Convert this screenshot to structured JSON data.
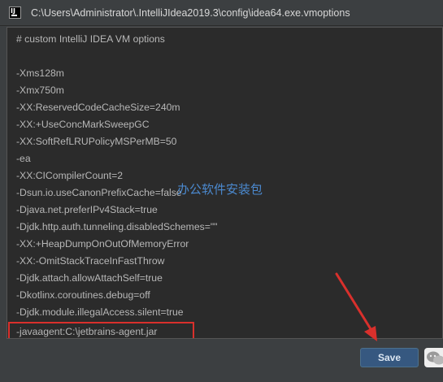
{
  "window": {
    "title": "C:\\Users\\Administrator\\.IntelliJIdea2019.3\\config\\idea64.exe.vmoptions",
    "icon_label": "IJ"
  },
  "editor": {
    "lines": [
      "# custom IntelliJ IDEA VM options",
      "",
      "-Xms128m",
      "-Xmx750m",
      "-XX:ReservedCodeCacheSize=240m",
      "-XX:+UseConcMarkSweepGC",
      "-XX:SoftRefLRUPolicyMSPerMB=50",
      "-ea",
      "-XX:CICompilerCount=2",
      "-Dsun.io.useCanonPrefixCache=false",
      "-Djava.net.preferIPv4Stack=true",
      "-Djdk.http.auth.tunneling.disabledSchemes=\"\"",
      "-XX:+HeapDumpOnOutOfMemoryError",
      "-XX:-OmitStackTraceInFastThrow",
      "-Djdk.attach.allowAttachSelf=true",
      "-Dkotlinx.coroutines.debug=off",
      "-Djdk.module.illegalAccess.silent=true",
      "-javaagent:C:\\jetbrains-agent.jar"
    ]
  },
  "watermark": "办公软件安装包",
  "footer": {
    "save_label": "Save"
  },
  "colors": {
    "background": "#3c3f41",
    "editor_bg": "#2b2b2b",
    "text": "#b7b7b7",
    "save_button": "#365880",
    "annotation_red": "#d9302c",
    "watermark_blue": "#4d8fd8"
  },
  "icons": [
    "intellij-app-icon",
    "wechat-icon",
    "red-arrow-annotation"
  ]
}
